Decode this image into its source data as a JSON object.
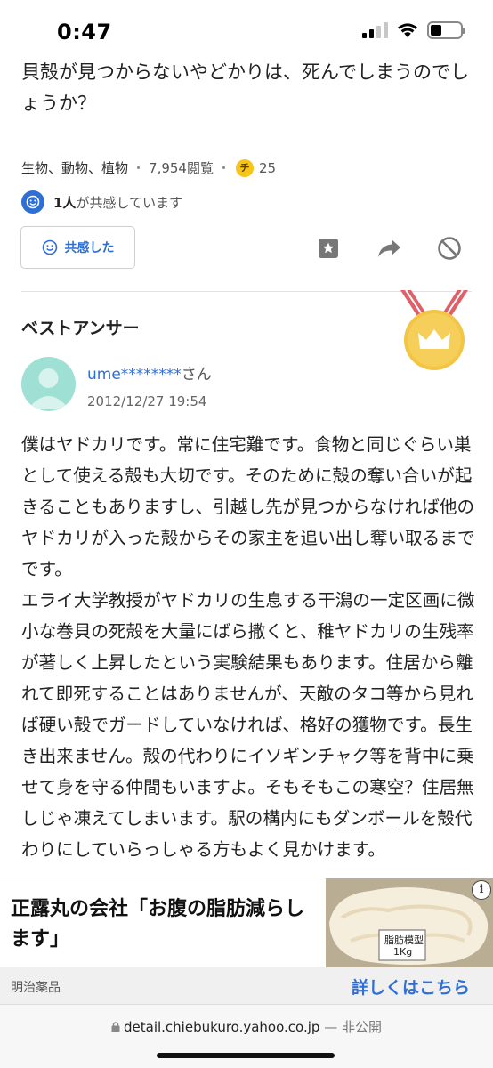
{
  "status_bar": {
    "time": "0:47"
  },
  "question": {
    "text": "貝殻が見つからないやどかりは、死んでしまうのでしょうか？"
  },
  "meta": {
    "category": "生物、動物、植物",
    "separator": "・",
    "views": "7,954閲覧",
    "coin_glyph": "チ",
    "coins": "25"
  },
  "empathy": {
    "count": "1人",
    "suffix": "が共感しています",
    "button_label": "共感した"
  },
  "actions": [
    "bookmark-icon",
    "share-icon",
    "block-icon"
  ],
  "best_answer": {
    "title": "ベストアンサー",
    "user": "ume********",
    "honorific": "さん",
    "date": "2012/12/27 19:54",
    "body_1": "僕はヤドカリです。常に住宅難です。食物と同じぐらい巣として使える殻も大切です。そのために殻の奪い合いが起きることもありますし、引越し先が見つからなければ他のヤドカリが入った殻からその家主を追い出し奪い取るまでです。\nエライ大学教授がヤドカリの生息する干潟の一定区画に微小な巻貝の死殻を大量にばら撒くと、稚ヤドカリの生残率が著しく上昇したという実験結果もあります。住居から離れて即死することはありませんが、天敵のタコ等から見れば硬い殻でガードしていなければ、格好の獲物です。長生き出来ません。殻の代わりにイソギンチャク等を背中に乗せて身を守る仲間もいますよ。そもそもこの寒空？住居無しじゃ凍えてしまいます。駅の構内にも",
    "link": "ダンボール",
    "body_2": "を殻代わりにしていらっしゃる方もよく見かけます。"
  },
  "ad": {
    "headline": "正露丸の会社「お腹の脂肪減らします」",
    "image_label_1": "脂肪模型",
    "image_label_2": "1Kg",
    "sponsor": "明治薬品",
    "cta": "詳しくはこちら",
    "info": "i"
  },
  "url_bar": {
    "domain": "detail.chiebukuro.yahoo.co.jp",
    "sep": " — ",
    "privacy": "非公開"
  },
  "colors": {
    "accent": "#2f6fd4",
    "medal_gold": "#f2c544",
    "medal_ribbon": "#e0606a"
  }
}
